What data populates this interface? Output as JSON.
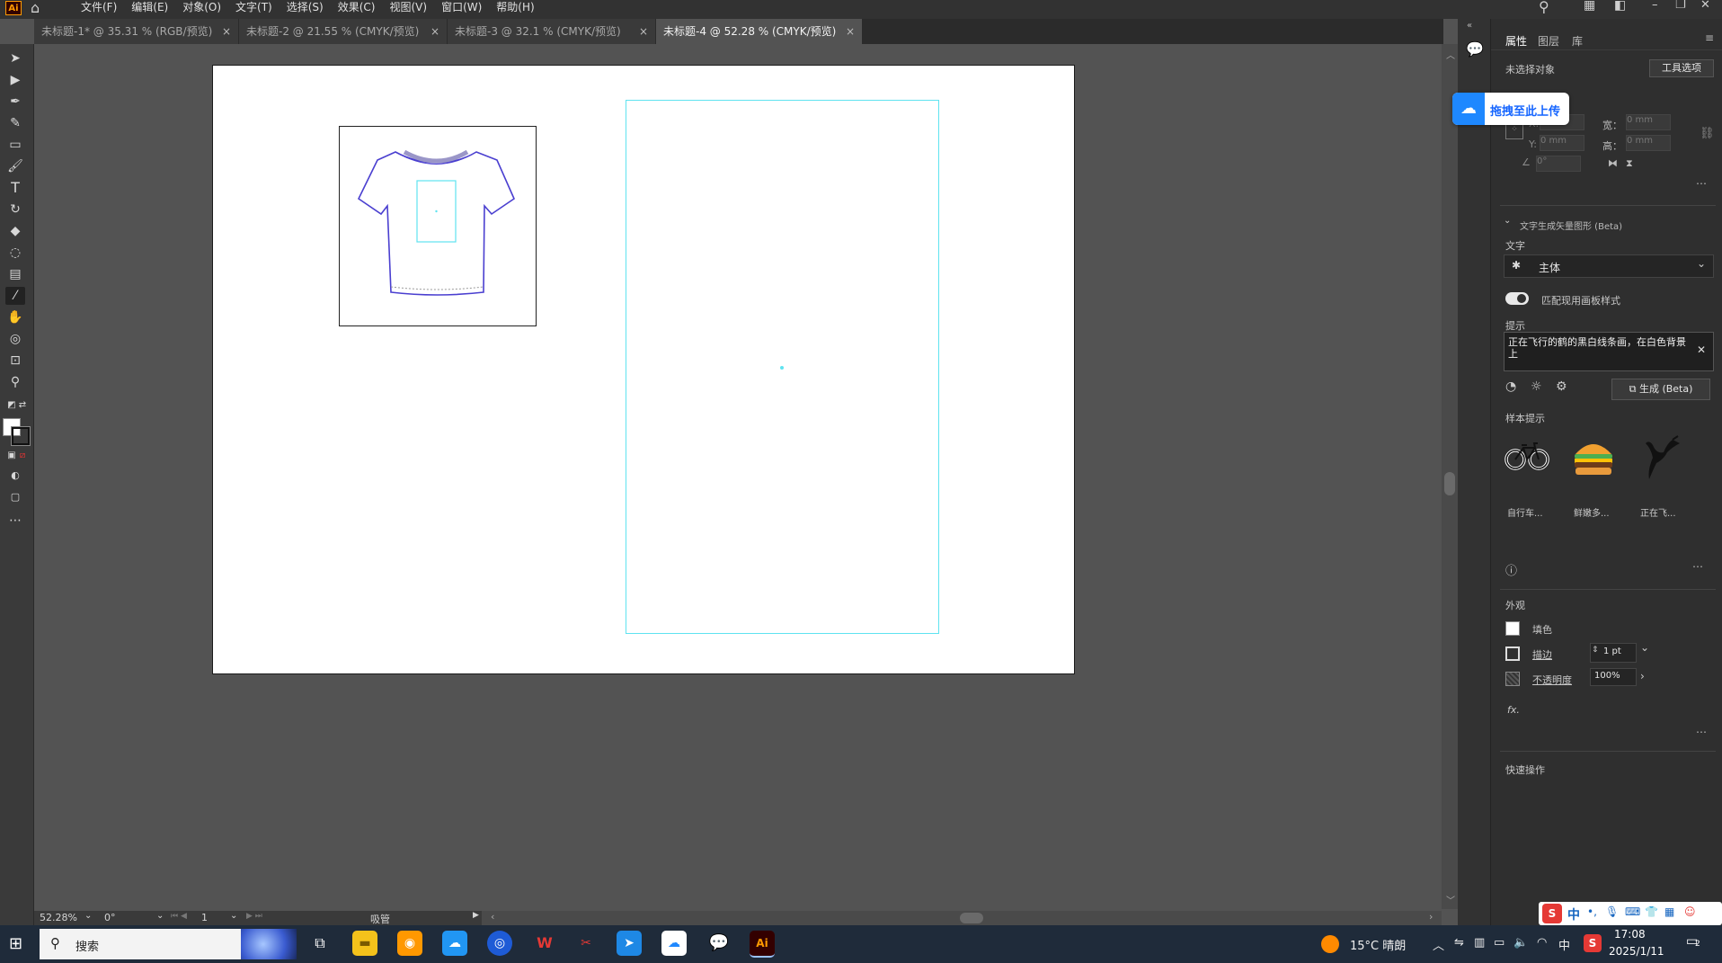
{
  "menubar": {
    "app_logo": "Ai",
    "items": [
      "文件(F)",
      "编辑(E)",
      "对象(O)",
      "文字(T)",
      "选择(S)",
      "效果(C)",
      "视图(V)",
      "窗口(W)",
      "帮助(H)"
    ]
  },
  "tabs": [
    {
      "label": "未标题-1* @ 35.31 % (RGB/预览)",
      "active": false
    },
    {
      "label": "未标题-2 @ 21.55 % (CMYK/预览)",
      "active": false
    },
    {
      "label": "未标题-3 @ 32.1 % (CMYK/预览)",
      "active": false
    },
    {
      "label": "未标题-4 @ 52.28 % (CMYK/预览)",
      "active": true
    }
  ],
  "tab_close": "×",
  "statusbar": {
    "zoom": "52.28%",
    "rotation": "0°",
    "artboard_num": "1",
    "mode": "吸管"
  },
  "panel": {
    "tabs": [
      "属性",
      "图层",
      "库"
    ],
    "no_selection": "未选择对象",
    "tool_options": "工具选项",
    "transform": {
      "x_label": "X:",
      "y_label": "Y:",
      "w_label": "宽：",
      "h_label": "高：",
      "x_val": "0 mm",
      "y_val": "0 mm",
      "w_val": "0 mm",
      "h_val": "0 mm",
      "angle_val": "0°"
    },
    "textgen": {
      "section_title": "文字生成矢量图形 (Beta)",
      "text_label": "文字",
      "subject": "主体",
      "match_style": "匹配现用画板样式",
      "prompt_label": "提示",
      "prompt_value": "正在飞行的鹤的黑白线条画，在白色背景上",
      "generate": "生成 (Beta)",
      "samples_label": "样本提示",
      "samples": [
        "自行车...",
        "鲜嫩多...",
        "正在飞..."
      ]
    },
    "appearance": {
      "title": "外观",
      "fill": "填色",
      "stroke": "描边",
      "stroke_val": "1 pt",
      "opacity": "不透明度",
      "opacity_val": "100%",
      "fx": "fx."
    },
    "quick_actions": "快速操作",
    "upload_badge": "拖拽至此上传"
  },
  "taskbar": {
    "search": "搜索",
    "weather": "15°C  晴朗",
    "ime": "中",
    "time": "17:08",
    "date": "2025/1/11",
    "notifications": "2"
  },
  "colors": {
    "accent_cyan": "#5fe3f0",
    "tshirt_stroke": "#4a3fd0",
    "panel_bg": "#2f2f2f",
    "workspace_bg": "#535353"
  }
}
